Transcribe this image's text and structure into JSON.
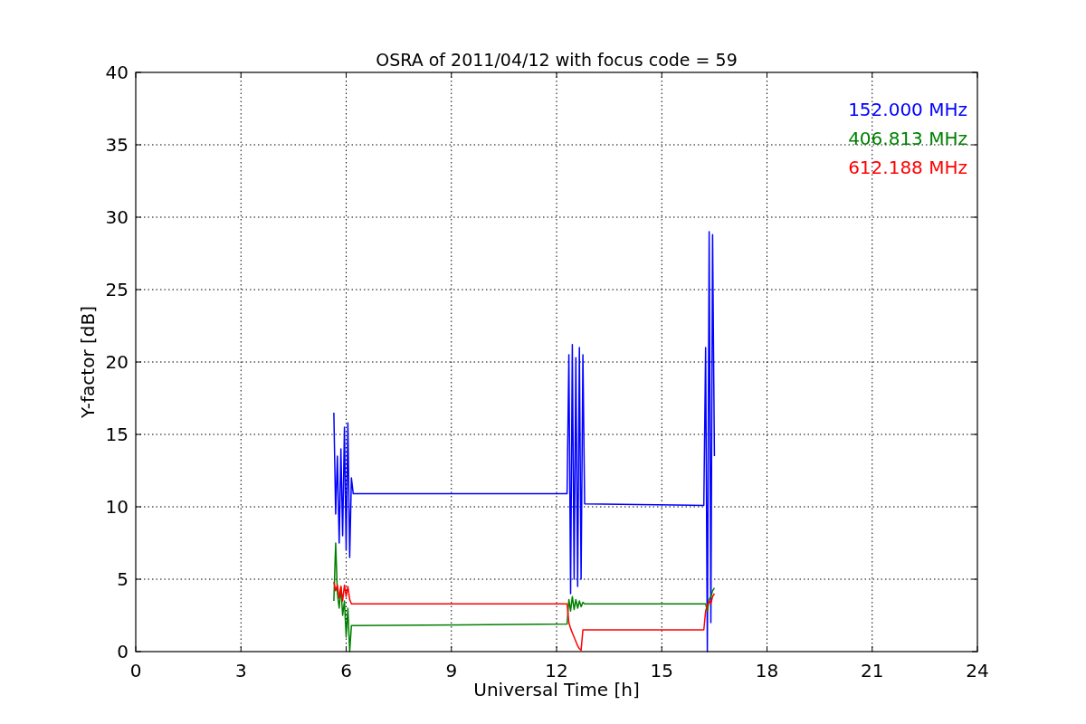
{
  "chart": {
    "chart_data": {
      "type": "line",
      "title": "OSRA of 2011/04/12 with focus code = 59",
      "xlabel": "Universal Time [h]",
      "ylabel": "Y-factor [dB]",
      "xlim": [
        0,
        24
      ],
      "ylim": [
        0,
        40
      ],
      "xticks": [
        0,
        3,
        6,
        9,
        12,
        15,
        18,
        21,
        24
      ],
      "yticks": [
        0,
        5,
        10,
        15,
        20,
        25,
        30,
        35,
        40
      ],
      "grid": true,
      "x": [
        5.65,
        5.7,
        5.75,
        5.8,
        5.85,
        5.9,
        5.95,
        6.0,
        6.05,
        6.1,
        6.15,
        6.2,
        12.3,
        12.35,
        12.4,
        12.45,
        12.5,
        12.55,
        12.6,
        12.65,
        12.7,
        12.75,
        12.8,
        16.2,
        16.25,
        16.3,
        16.35,
        16.4,
        16.45,
        16.5
      ],
      "series": [
        {
          "name": "152.000 MHz",
          "color": "#0000ff",
          "values": [
            16.5,
            9.5,
            13.5,
            7.5,
            14,
            8,
            15.5,
            7,
            15.8,
            6.5,
            12,
            10.9,
            10.9,
            20.5,
            4,
            21.2,
            5,
            20.3,
            4.5,
            21,
            5,
            20.5,
            10.2,
            10.1,
            21,
            0,
            29,
            2,
            28.8,
            13.5
          ]
        },
        {
          "name": "406.813 MHz",
          "color": "#008000",
          "values": [
            3.5,
            7.5,
            4,
            3,
            4.5,
            2.5,
            3.5,
            1,
            3,
            0,
            1.8,
            1.8,
            1.9,
            3.6,
            2.8,
            3.8,
            2.9,
            3.6,
            3,
            3.5,
            3.1,
            3.4,
            3.3,
            3.3,
            3.3,
            2.8,
            3.6,
            3.8,
            4.2,
            4.4
          ]
        },
        {
          "name": "612.188 MHz",
          "color": "#ff0000",
          "values": [
            4.8,
            4.2,
            4.6,
            3.7,
            4.5,
            3.5,
            4.6,
            3.8,
            4.5,
            3.6,
            3.3,
            3.3,
            3.3,
            2,
            1.6,
            1.3,
            1,
            0.7,
            0.4,
            0.2,
            0.1,
            1.5,
            1.5,
            1.5,
            2.8,
            3.2,
            3.5,
            3.3,
            3.8,
            4
          ]
        }
      ]
    }
  }
}
